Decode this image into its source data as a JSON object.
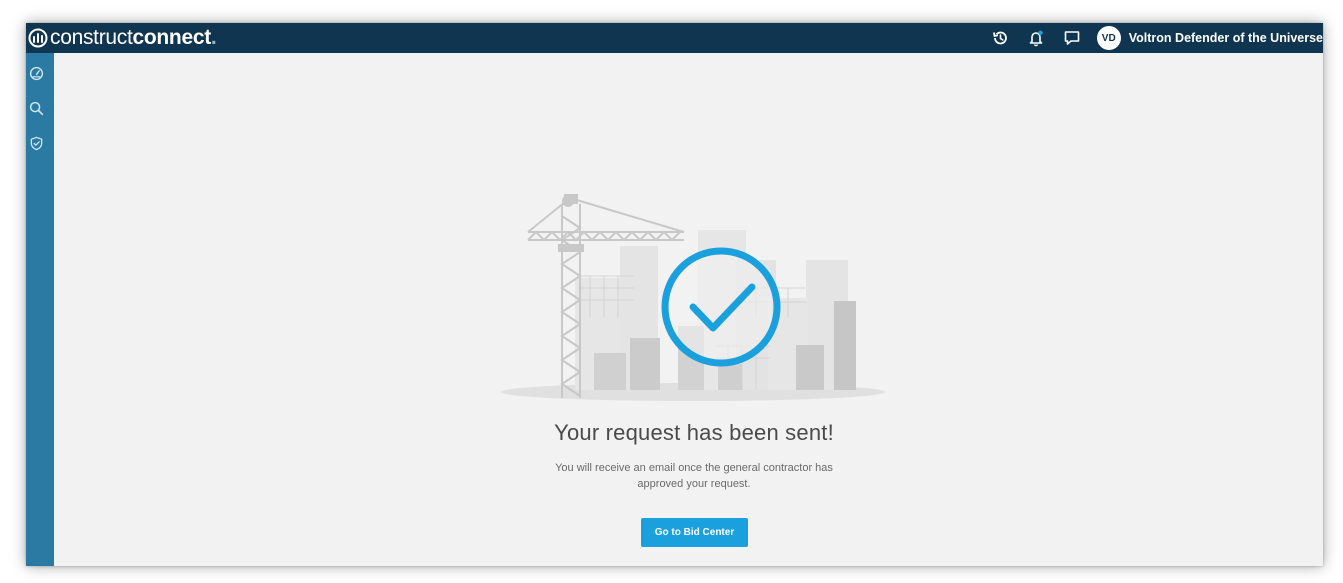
{
  "header": {
    "logo": {
      "part1": "construct",
      "part2": "connect",
      "dot": "."
    },
    "icons": [
      "history-icon",
      "bell-icon",
      "chat-icon"
    ],
    "user": {
      "initials": "VD",
      "name": "Voltron Defender of the Universe"
    }
  },
  "sidebar": {
    "items": [
      {
        "icon": "dashboard-icon"
      },
      {
        "icon": "search-icon"
      },
      {
        "icon": "shield-check-icon"
      }
    ]
  },
  "main": {
    "title": "Your request has been sent!",
    "message": "You will receive an email once the general contractor has approved your request.",
    "button_label": "Go to Bid Center"
  },
  "colors": {
    "header_bg": "#0f3550",
    "sidebar_bg": "#2a7aa3",
    "accent": "#1aa0dd",
    "page_bg": "#f2f2f2"
  }
}
